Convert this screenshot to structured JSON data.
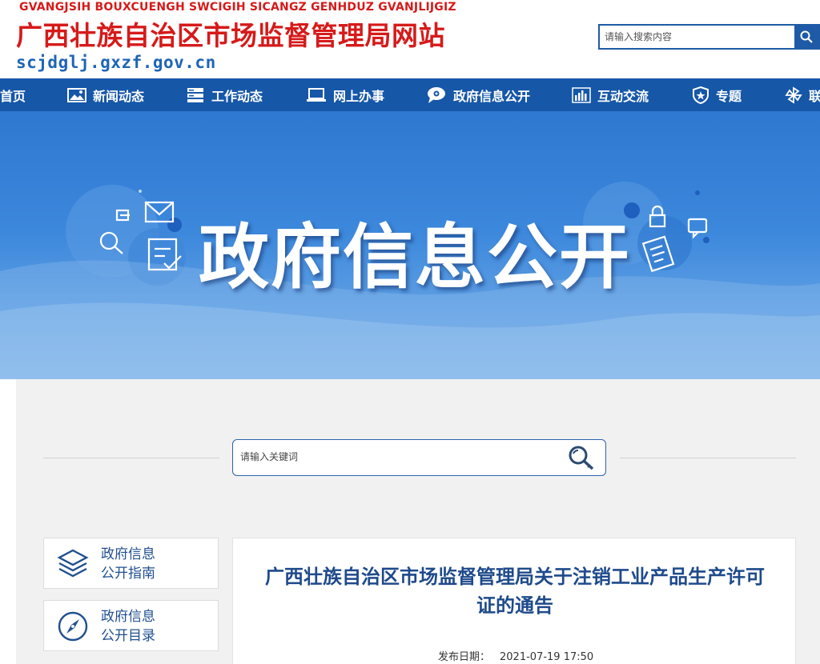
{
  "header": {
    "zhuang_name": "GVANGJSIH BOUXCUENGH SWCIGIH SICANGZ GENHDUZ GVANJLIJGIZ",
    "site_title": "广西壮族自治区市场监督管理局网站",
    "domain": "scjdglj.gxzf.gov.cn",
    "search_placeholder": "请输入搜索内容"
  },
  "nav": {
    "items": [
      {
        "label": "首页",
        "icon": "home-icon"
      },
      {
        "label": "新闻动态",
        "icon": "picture-icon"
      },
      {
        "label": "工作动态",
        "icon": "server-icon"
      },
      {
        "label": "网上办事",
        "icon": "laptop-icon"
      },
      {
        "label": "政府信息公开",
        "icon": "eye-chat-icon"
      },
      {
        "label": "互动交流",
        "icon": "bar-chart-icon"
      },
      {
        "label": "专题",
        "icon": "shield-star-icon"
      },
      {
        "label": "联",
        "icon": "pinwheel-icon"
      }
    ]
  },
  "banner": {
    "title": "政府信息公开"
  },
  "search": {
    "placeholder": "请输入关键词"
  },
  "sidebar": {
    "items": [
      {
        "line1": "政府信息",
        "line2": "公开指南",
        "icon": "layers-icon"
      },
      {
        "line1": "政府信息",
        "line2": "公开目录",
        "icon": "compass-icon"
      }
    ]
  },
  "article": {
    "title": "广西壮族自治区市场监督管理局关于注销工业产品生产许可证的通告",
    "publish_label": "发布日期：",
    "publish_date": "2021-07-19 17:50"
  },
  "colors": {
    "brand_red": "#d61a1a",
    "nav_blue": "#1657a8",
    "title_blue": "#1e4a8b"
  }
}
